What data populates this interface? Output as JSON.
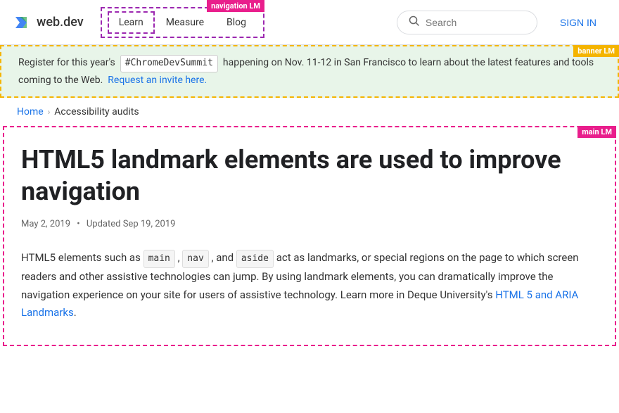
{
  "header": {
    "logo_text": "web.dev",
    "nav_label": "navigation LM",
    "nav_items": [
      "Learn",
      "Measure",
      "Blog"
    ],
    "search_placeholder": "Search",
    "signin_label": "SIGN IN"
  },
  "banner": {
    "label": "banner LM",
    "text_before": "Register for this year's",
    "hashtag": "#ChromeDevSummit",
    "text_after": "happening on Nov. 11-12 in San Francisco to learn about the latest features and tools coming to the Web.",
    "link_text": "Request an invite here."
  },
  "breadcrumb": {
    "home": "Home",
    "separator": "›",
    "current": "Accessibility audits"
  },
  "main": {
    "label": "main LM",
    "title": "HTML5 landmark elements are used to improve navigation",
    "date": "May 2, 2019",
    "updated": "Updated Sep 19, 2019",
    "body_intro": "HTML5 elements such as",
    "code1": "main",
    "body_comma1": ",",
    "code2": "nav",
    "body_and": ", and",
    "code3": "aside",
    "body_part2": "act as landmarks, or special regions on the page to which screen readers and other assistive technologies can jump. By using landmark elements, you can dramatically improve the navigation experience on your site for users of assistive technology. Learn more in Deque University's",
    "link_text": "HTML 5 and ARIA Landmarks",
    "body_end": "."
  }
}
